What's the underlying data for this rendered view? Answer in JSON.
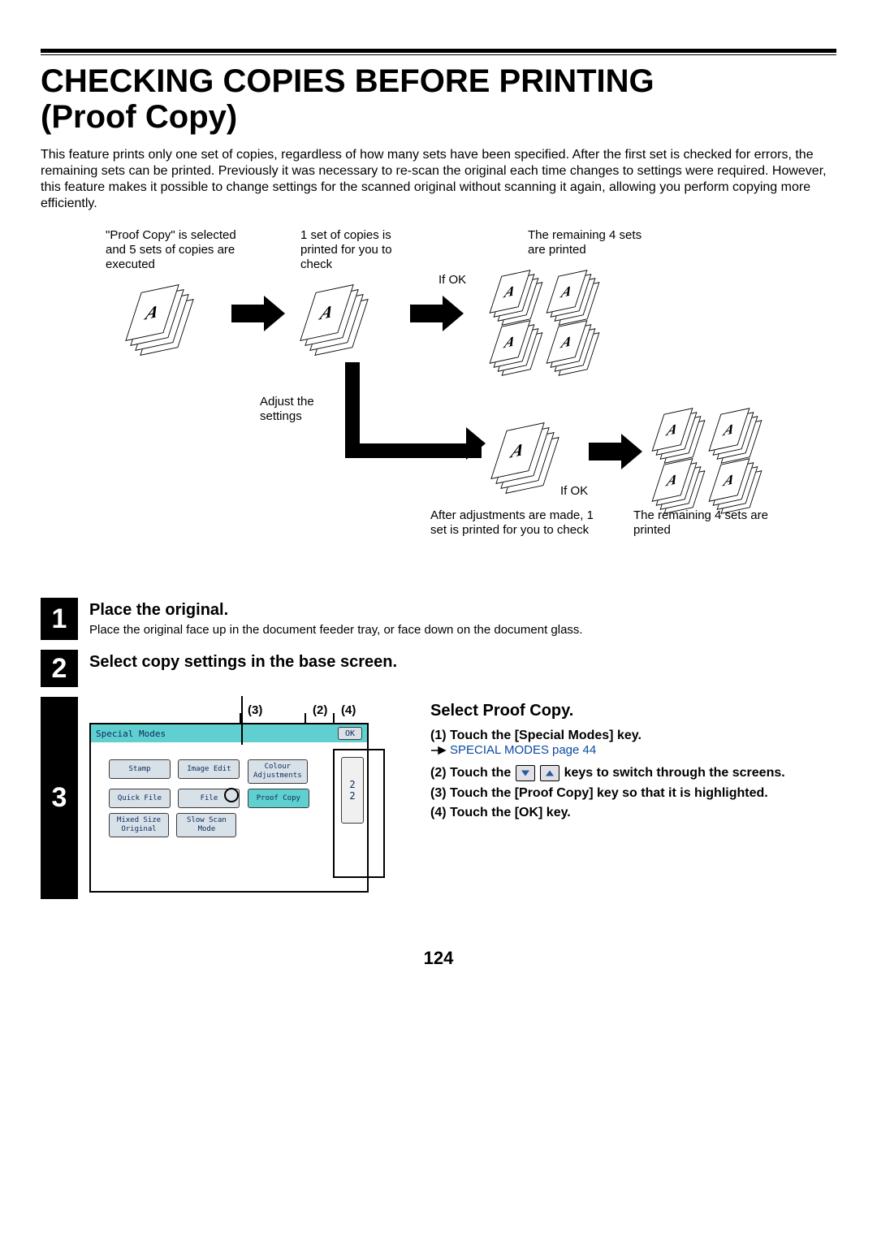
{
  "title_line1": "CHECKING COPIES BEFORE PRINTING",
  "title_line2": "(Proof Copy)",
  "intro": "This feature prints only one set of copies, regardless of how many sets have been specified. After the first set is checked for errors, the remaining sets can be printed. Previously it was necessary to re-scan the original each time changes to settings were required. However, this feature makes it possible to change settings for the scanned original without scanning it again, allowing you perform copying more efficiently.",
  "diagram": {
    "cap1": "\"Proof Copy\" is selected and 5 sets of copies are executed",
    "cap2": "1 set of copies is printed for you to check",
    "cap3": "The remaining 4 sets are printed",
    "if_ok_top": "If OK",
    "adjust": "Adjust the settings",
    "cap4": "After adjustments are made, 1 set is printed for you to check",
    "if_ok_bot": "If OK",
    "cap5": "The remaining 4 sets are printed",
    "glyph": "A"
  },
  "steps": {
    "n1": "1",
    "s1_title": "Place the original.",
    "s1_body": "Place the original face up in the document feeder tray, or face down on the document glass.",
    "n2": "2",
    "s2_title": "Select copy settings in the base screen.",
    "n3": "3",
    "s3_title": "Select Proof Copy.",
    "panel_header": "Special Modes",
    "panel_ok": "OK",
    "panel_buttons": {
      "stamp": "Stamp",
      "image_edit": "Image Edit",
      "colour_adj1": "Colour",
      "colour_adj2": "Adjustments",
      "quick_file": "Quick File",
      "file": "File",
      "proof_copy": "Proof Copy",
      "mixed1": "Mixed Size",
      "mixed2": "Original",
      "slow1": "Slow Scan",
      "slow2": "Mode"
    },
    "panel_page_top": "2",
    "panel_page_bot": "2",
    "panel_label3": "(3)",
    "panel_label2": "(2)",
    "panel_label4": "(4)",
    "li1_pre": "(1)  Touch the [Special Modes] key.",
    "li1_link": "SPECIAL MODES",
    "li1_link_after": " page 44",
    "li2_a": "(2)  Touch the ",
    "li2_b": " keys to switch through the screens.",
    "li3": "(3)  Touch the [Proof Copy] key so that it is highlighted.",
    "li4": "(4)  Touch the [OK] key."
  },
  "page_number": "124"
}
